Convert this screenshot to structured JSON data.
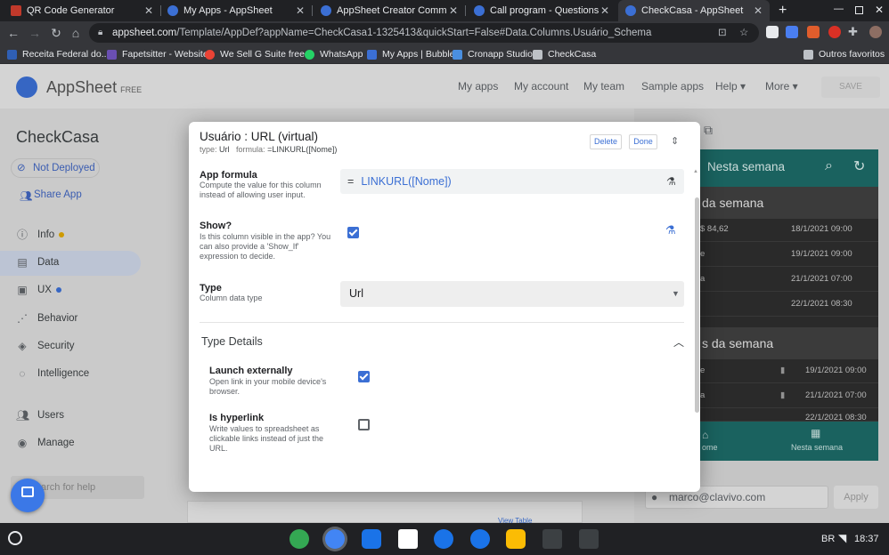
{
  "browser": {
    "tabs": [
      {
        "title": "QR Code Generator",
        "color": "#c0392b"
      },
      {
        "title": "My Apps - AppSheet",
        "color": "#3b6fd4"
      },
      {
        "title": "AppSheet Creator Community - E",
        "color": "#3b6fd4"
      },
      {
        "title": "Call program - Questions - AppS",
        "color": "#3b6fd4"
      },
      {
        "title": "CheckCasa - AppSheet",
        "color": "#3b6fd4"
      }
    ],
    "url_host": "appsheet.com",
    "url_path": "/Template/AppDef?appName=CheckCasa1-1325413&quickStart=False#Data.Columns.Usuário_Schema",
    "bookmarks": [
      "Receita Federal do...",
      "Fapetsitter - Website",
      "We Sell G Suite free...",
      "WhatsApp",
      "My Apps | Bubble",
      "Cronapp Studio",
      "CheckCasa"
    ],
    "other_bookmarks": "Outros favoritos"
  },
  "header": {
    "brand": "AppSheet",
    "plan": "FREE",
    "nav": [
      "My apps",
      "My account",
      "My team",
      "Sample apps",
      "Help",
      "More"
    ],
    "save": "SAVE"
  },
  "sidebar": {
    "app_name": "CheckCasa",
    "deploy_status": "Not Deployed",
    "share": "Share App",
    "items": [
      {
        "label": "Info",
        "icon": "info-icon",
        "dot": "#e0a800"
      },
      {
        "label": "Data",
        "icon": "table-icon"
      },
      {
        "label": "UX",
        "icon": "ux-icon",
        "dot": "#3b6fd4"
      },
      {
        "label": "Behavior",
        "icon": "behavior-icon"
      },
      {
        "label": "Security",
        "icon": "shield-icon"
      },
      {
        "label": "Intelligence",
        "icon": "bulb-icon"
      },
      {
        "label": "Users",
        "icon": "users-icon"
      },
      {
        "label": "Manage",
        "icon": "manage-icon"
      }
    ],
    "search_placeholder": "arch for help"
  },
  "modal": {
    "title": "Usuário : URL (virtual)",
    "subtitle_type_label": "type:",
    "subtitle_type": "Url",
    "subtitle_formula_label": "formula:",
    "subtitle_formula": "=LINKURL([Nome])",
    "delete": "Delete",
    "done": "Done",
    "app_formula": {
      "label": "App formula",
      "help": "Compute the value for this column instead of allowing user input.",
      "value": "LINKURL([Nome])",
      "prefix": "="
    },
    "show": {
      "label": "Show?",
      "help": "Is this column visible in the app? You can also provide a 'Show_If' expression to decide.",
      "checked": true
    },
    "type": {
      "label": "Type",
      "help": "Column data type",
      "value": "Url"
    },
    "type_details": {
      "heading": "Type Details",
      "launch": {
        "label": "Launch externally",
        "help": "Open link in your mobile device's browser.",
        "checked": true
      },
      "hyperlink": {
        "label": "Is hyperlink",
        "help": "Write values to spreadsheet as clickable links instead of just the URL.",
        "checked": false
      }
    }
  },
  "preview": {
    "view_title": "Nesta semana",
    "section1": "da semana",
    "rows1": [
      {
        "left": "$ 84,62",
        "right": "18/1/2021 09:00"
      },
      {
        "left": "e",
        "right": "19/1/2021 09:00"
      },
      {
        "left": "a",
        "right": "21/1/2021 07:00"
      },
      {
        "left": "",
        "right": "22/1/2021 08:30"
      }
    ],
    "section2": "s da semana",
    "rows2": [
      {
        "left": "e",
        "right": "19/1/2021 09:00"
      },
      {
        "left": "a",
        "right": "21/1/2021 07:00"
      },
      {
        "left": "",
        "right": "22/1/2021 08:30"
      }
    ],
    "nav_left": "ome",
    "nav_right": "Nesta semana",
    "email": "marco@clavivo.com",
    "apply": "Apply",
    "table_link": "View Table"
  },
  "os": {
    "lang": "BR",
    "time": "18:37"
  }
}
